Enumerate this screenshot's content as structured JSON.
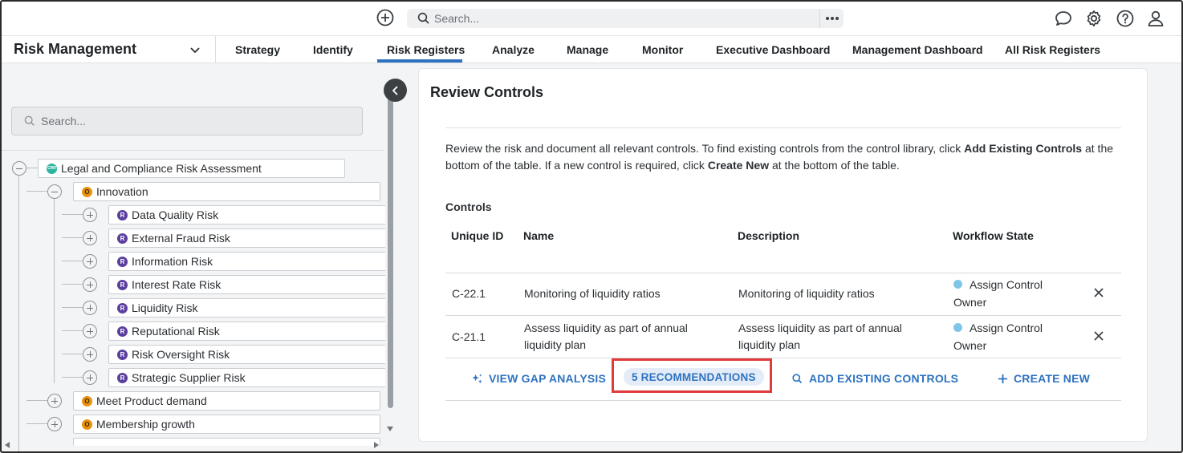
{
  "topbar": {
    "search_placeholder": "Search...",
    "icons": [
      "plus-circle-icon",
      "search-icon",
      "ellipsis-icon",
      "chat-icon",
      "gear-icon",
      "help-icon",
      "user-icon"
    ]
  },
  "app": {
    "title": "Risk Management"
  },
  "nav": {
    "tabs": [
      {
        "label": "Strategy",
        "active": false
      },
      {
        "label": "Identify",
        "active": false
      },
      {
        "label": "Risk Registers",
        "active": true
      },
      {
        "label": "Analyze",
        "active": false
      },
      {
        "label": "Manage",
        "active": false
      },
      {
        "label": "Monitor",
        "active": false
      },
      {
        "label": "Executive Dashboard",
        "active": false
      },
      {
        "label": "Management Dashboard",
        "active": false
      },
      {
        "label": "All Risk Registers",
        "active": false
      }
    ]
  },
  "tree": {
    "search_placeholder": "Search...",
    "root": {
      "badge": "CRR",
      "label": "Legal and Compliance Risk Assessment"
    },
    "innovation": {
      "badge": "O",
      "label": "Innovation"
    },
    "risks": [
      {
        "badge": "R",
        "label": "Data Quality Risk"
      },
      {
        "badge": "R",
        "label": "External Fraud Risk"
      },
      {
        "badge": "R",
        "label": "Information Risk"
      },
      {
        "badge": "R",
        "label": "Interest Rate Risk"
      },
      {
        "badge": "R",
        "label": "Liquidity Risk"
      },
      {
        "badge": "R",
        "label": "Reputational Risk"
      },
      {
        "badge": "R",
        "label": "Risk Oversight Risk"
      },
      {
        "badge": "R",
        "label": "Strategic Supplier Risk"
      }
    ],
    "objectives": [
      {
        "badge": "O",
        "label": "Meet Product demand"
      },
      {
        "badge": "O",
        "label": "Membership growth"
      }
    ]
  },
  "main": {
    "title": "Review Controls",
    "desc_part1": "Review the risk and document all relevant controls. To find existing controls from the control library, click ",
    "desc_bold1": "Add Existing Controls",
    "desc_part2": " at the bottom of the table. If a new control is required, click ",
    "desc_bold2": "Create New",
    "desc_part3": " at the bottom of the table.",
    "section_label": "Controls",
    "columns": [
      "Unique ID",
      "Name",
      "Description",
      "Workflow State"
    ],
    "rows": [
      {
        "id": "C-22.1",
        "name_l1": "Monitoring of liquidity ratios",
        "name_l2": "",
        "desc_l1": "Monitoring of liquidity ratios",
        "desc_l2": "",
        "state_l1": "Assign Control",
        "state_l2": "Owner",
        "state_color": "#7ec6e8"
      },
      {
        "id": "C-21.1",
        "name_l1": "Assess liquidity as part of annual",
        "name_l2": "liquidity plan",
        "desc_l1": "Assess liquidity as part of annual",
        "desc_l2": "liquidity plan",
        "state_l1": "Assign Control",
        "state_l2": "Owner",
        "state_color": "#7ec6e8"
      }
    ],
    "actions": {
      "gap_analysis": "VIEW GAP ANALYSIS",
      "recommendations": "5 RECOMMENDATIONS",
      "add_existing": "ADD EXISTING CONTROLS",
      "create_new": "CREATE NEW"
    },
    "highlight_color": "#e03a3a",
    "accent_color": "#2e72c0"
  }
}
